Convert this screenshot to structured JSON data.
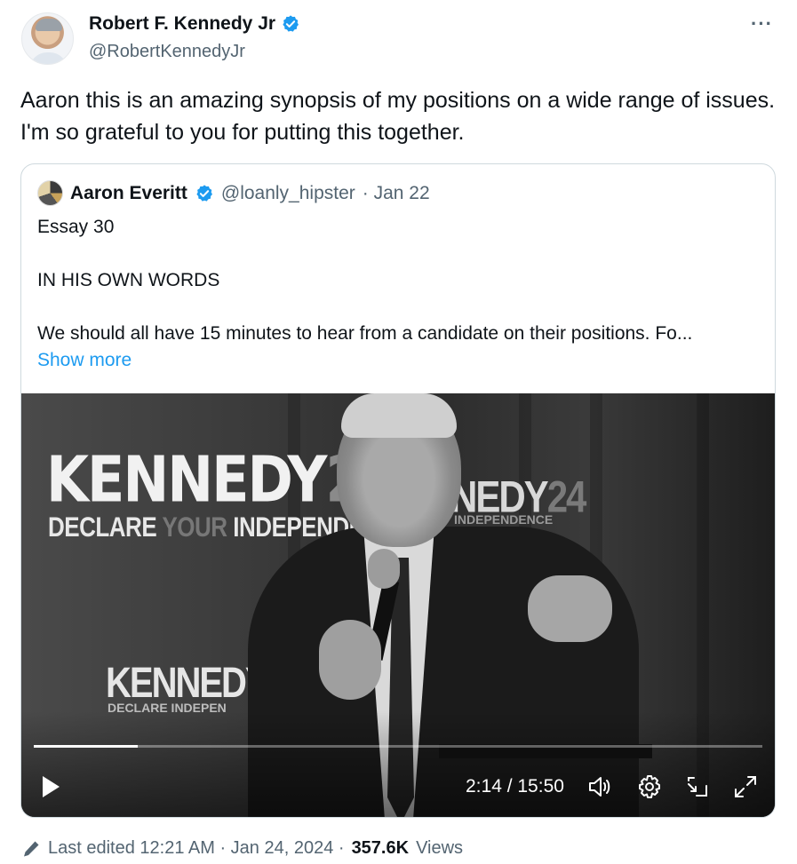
{
  "author": {
    "display_name": "Robert F. Kennedy Jr",
    "handle": "@RobertKennedyJr",
    "verified": true,
    "more_label": "···"
  },
  "tweet": {
    "text": "Aaron this is an amazing synopsis of my positions on a wide range of issues. I'm so grateful to you for putting this together."
  },
  "quote": {
    "display_name": "Aaron Everitt",
    "handle": "@loanly_hipster",
    "date": "· Jan 22",
    "verified": true,
    "lines": [
      "Essay 30",
      "IN HIS OWN WORDS",
      "We should all have 15 minutes to hear from a candidate on their positions. Fo..."
    ],
    "show_more": "Show more"
  },
  "video": {
    "sign_big": "KENNEDY",
    "sign_big_num": "24",
    "sign_sub_a": "DECLARE",
    "sign_sub_b": "YOUR",
    "sign_sub_c": "INDEPENDENCE",
    "sign_mid": "NEDY",
    "sign_mid_num": "24",
    "sign_mid_sub": "INDEPENDENCE",
    "sign_small": "KENNEDY",
    "sign_small_sub": "DECLARE   INDEPEN",
    "time_display": "2:14 / 15:50",
    "progress_fraction": 0.143
  },
  "footer": {
    "edited_label": "Last edited 12:21 AM · Jan 24, 2024 ·",
    "views_count": "357.6K",
    "views_label": "Views"
  },
  "colors": {
    "accent": "#1d9bf0",
    "secondary_text": "#536471",
    "primary_text": "#0f1419"
  }
}
